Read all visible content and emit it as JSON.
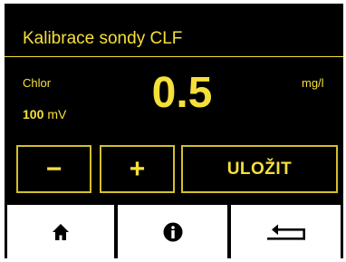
{
  "screen": {
    "title": "Kalibrace sondy CLF"
  },
  "measurement": {
    "parameter": "Chlor",
    "value": "0.5",
    "unit": "mg/l",
    "mv_value": "100",
    "mv_unit": "mV"
  },
  "controls": {
    "minus_label": "−",
    "plus_label": "+",
    "save_label": "ULOŽIT"
  },
  "navbar": {
    "items": [
      {
        "name": "home",
        "icon": "home-icon"
      },
      {
        "name": "info",
        "icon": "info-icon"
      },
      {
        "name": "back",
        "icon": "return-arrow-icon"
      }
    ]
  },
  "colors": {
    "accent": "#f5e03a",
    "background": "#000000",
    "nav_background": "#ffffff"
  }
}
